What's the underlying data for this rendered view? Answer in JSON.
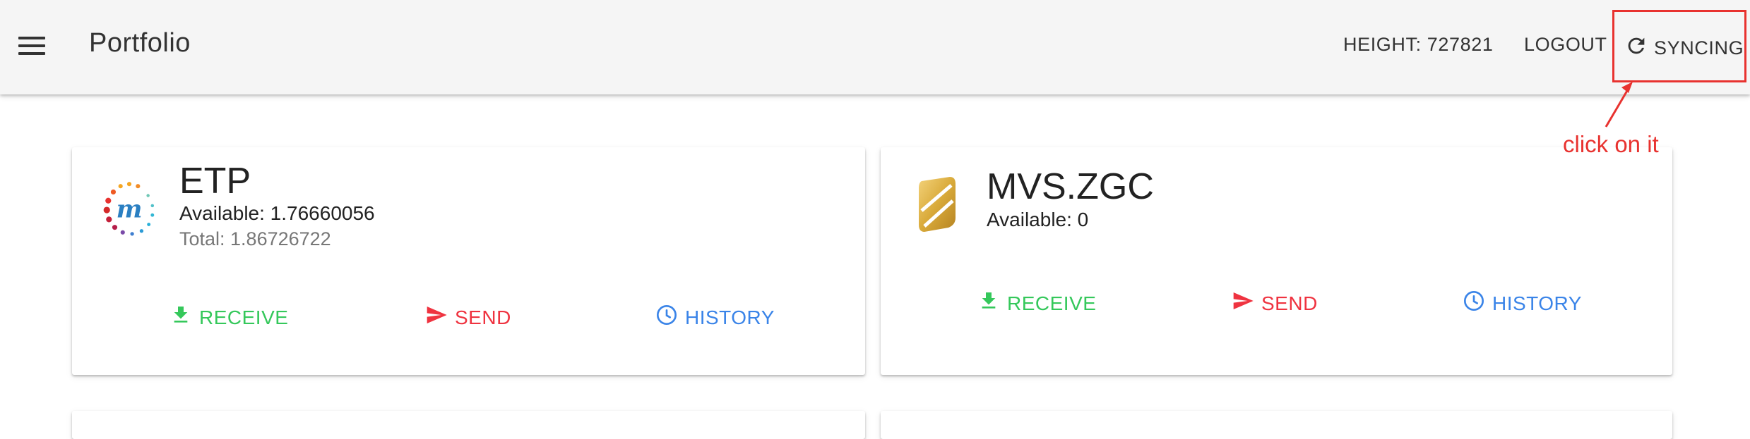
{
  "header": {
    "title": "Portfolio",
    "height_text": "HEIGHT: 727821",
    "logout_label": "LOGOUT",
    "syncing_label": "SYNCING"
  },
  "annotation": {
    "text": "click on it",
    "color": "#e8322f"
  },
  "assets": [
    {
      "name": "ETP",
      "available": "Available: 1.76660056",
      "total": "Total: 1.86726722",
      "icon": "metaverse-m-logo",
      "actions": {
        "receive": "RECEIVE",
        "send": "SEND",
        "history": "HISTORY"
      }
    },
    {
      "name": "MVS.ZGC",
      "available": "Available: 0",
      "icon": "gold-shield-logo",
      "actions": {
        "receive": "RECEIVE",
        "send": "SEND",
        "history": "HISTORY"
      }
    }
  ],
  "colors": {
    "receive": "#35c85b",
    "send": "#ef3340",
    "history": "#3a84e8",
    "topbar": "#f5f5f5"
  }
}
